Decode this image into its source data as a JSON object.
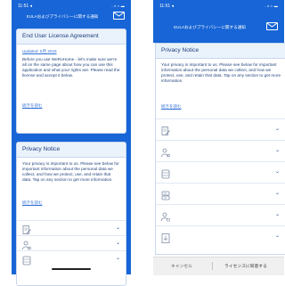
{
  "statusbar": {
    "time": "11:51 ◂",
    "icons": "..ıl ≈ ▬"
  },
  "header": {
    "title": "EULAおよびプライバシーに関する通知"
  },
  "eula": {
    "title": "End User License Agreement",
    "updated": "Updated: 5月 2018",
    "body": "Before you use WeRoHome - let's make sure we're all on the same page about how you can use this application and what your rights are. Please read the license and accept it below.",
    "link": "続きを読む"
  },
  "privacy": {
    "title": "Privacy Notice",
    "body": "Your privacy is important to us. Please see below for important information about the personal data we collect, and how we protect, use, and retain that data. Tap on any section to get more information.",
    "link": "続きを読む"
  },
  "privacy_sections_left": [
    {
      "icon": "document-edit-icon"
    },
    {
      "icon": "user-settings-icon"
    },
    {
      "icon": "database-icon"
    }
  ],
  "privacy_sections_right": [
    {
      "icon": "document-edit-icon"
    },
    {
      "icon": "user-settings-icon"
    },
    {
      "icon": "database-icon"
    },
    {
      "icon": "server-icon"
    },
    {
      "icon": "user-lock-icon"
    },
    {
      "icon": "download-icon"
    }
  ],
  "footer": {
    "decline": "キャンセル",
    "accept": "ライセンスに同意する"
  },
  "colors": {
    "primary": "#1765d6",
    "card_header": "#eaf2fc",
    "link": "#2f6fd6",
    "text": "#1f3f7a"
  }
}
